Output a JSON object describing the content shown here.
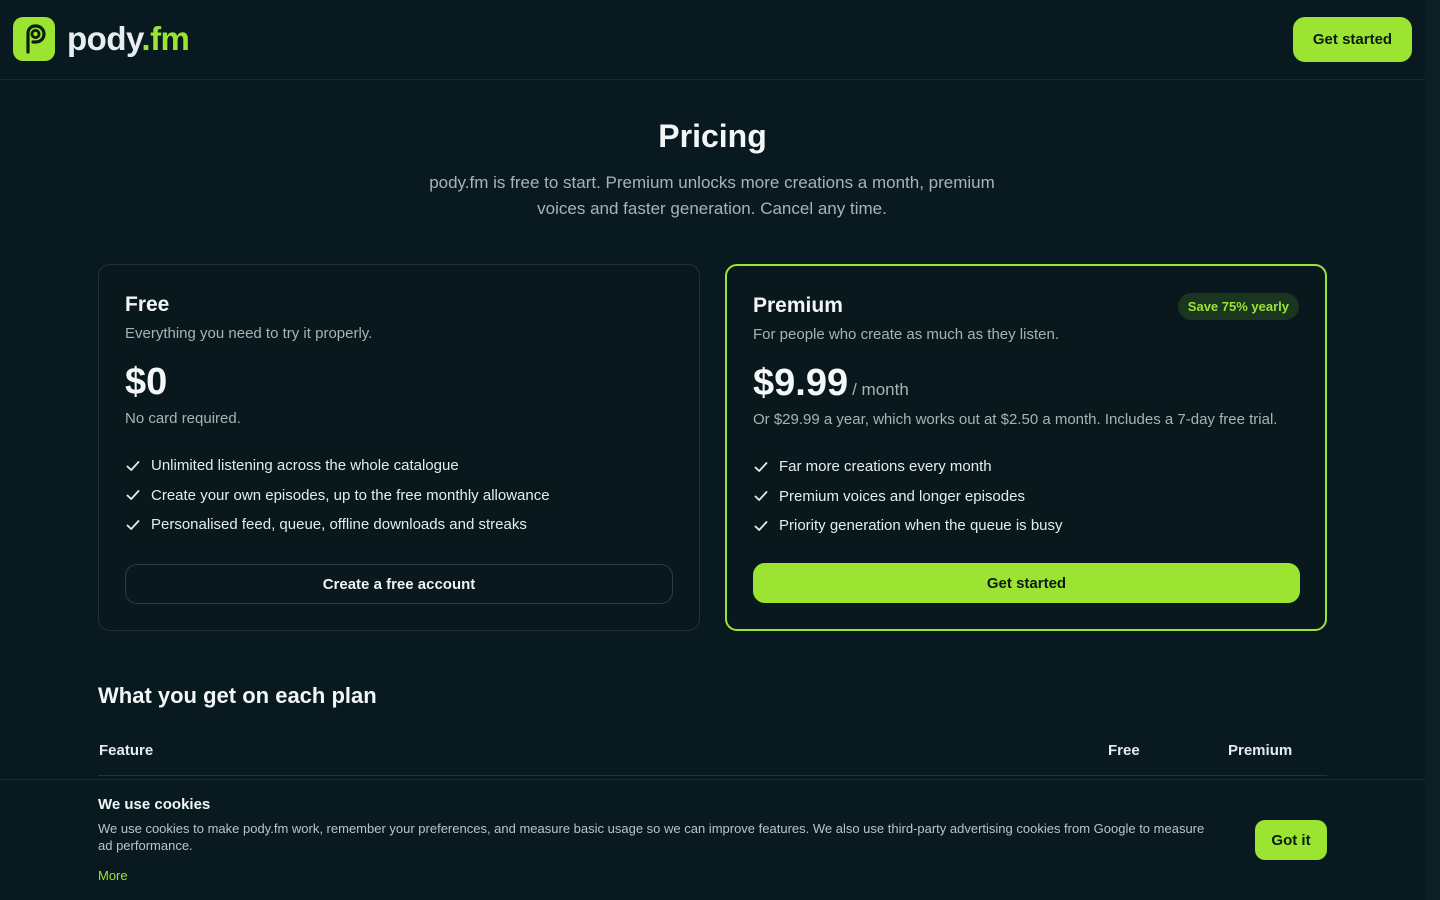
{
  "brand": {
    "name_main": "pody",
    "name_dot": ".",
    "name_tld": "fm",
    "accent": "#9be432"
  },
  "header": {
    "cta_label": "Get started"
  },
  "hero": {
    "title": "Pricing",
    "subtitle": "pody.fm is free to start. Premium unlocks more creations a month, premium voices and faster generation. Cancel any time."
  },
  "plans": {
    "free": {
      "title": "Free",
      "desc": "Everything you need to try it properly.",
      "price": "$0",
      "note": "No card required.",
      "features": [
        "Unlimited listening across the whole catalogue",
        "Create your own episodes, up to the free monthly allowance",
        "Personalised feed, queue, offline downloads and streaks"
      ],
      "cta_label": "Create a free account"
    },
    "premium": {
      "title": "Premium",
      "badge": "Save 75% yearly",
      "desc": "For people who create as much as they listen.",
      "price": "$9.99",
      "per": "/ month",
      "note": "Or $29.99 a year, which works out at $2.50 a month. Includes a 7-day free trial.",
      "features": [
        "Far more creations every month",
        "Premium voices and longer episodes",
        "Priority generation when the queue is busy"
      ],
      "cta_label": "Get started"
    }
  },
  "comparison": {
    "title": "What you get on each plan",
    "headers": {
      "feature": "Feature",
      "free": "Free",
      "premium": "Premium"
    }
  },
  "cookie": {
    "title": "We use cookies",
    "text": "We use cookies to make pody.fm work, remember your preferences, and measure basic usage so we can improve features. We also use third-party advertising cookies from Google to measure ad performance.",
    "more_label": "More",
    "button_label": "Got it"
  }
}
